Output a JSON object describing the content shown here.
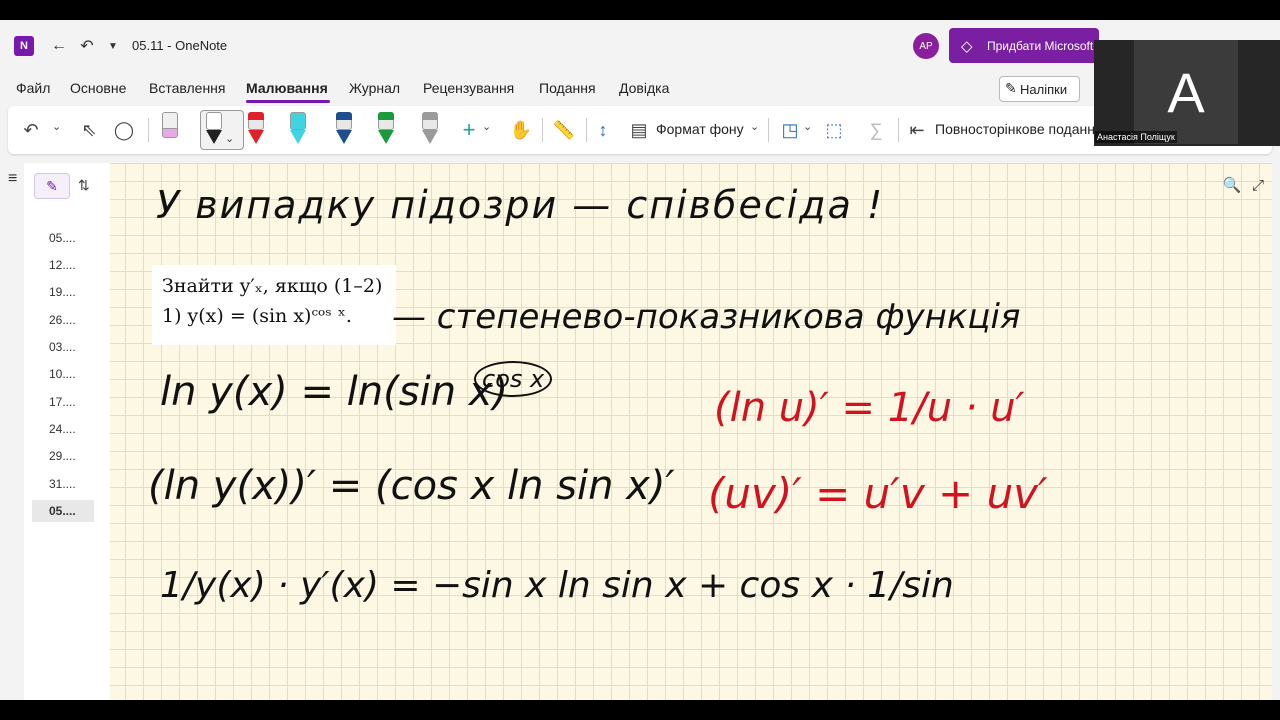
{
  "window": {
    "title": "05.11  -  OneNote",
    "avatar_initials": "AP",
    "buy_label": "Придбати Microsoft"
  },
  "menu": {
    "items": [
      "Файл",
      "Основне",
      "Вставлення",
      "Малювання",
      "Журнал",
      "Рецензування",
      "Подання",
      "Довідка"
    ],
    "active": "Малювання",
    "stickers_label": "Наліпки"
  },
  "toolbar": {
    "background_format_label": "Формат фону",
    "full_page_view_label": "Повносторінкове подання",
    "pen_colors": [
      "#222222",
      "#e0202a",
      "#3fd4e0",
      "#1f4e8c",
      "#1a9a3a",
      "#9a9a9a"
    ]
  },
  "sidebar": {
    "pages": [
      "05....",
      "12....",
      "19....",
      "26....",
      "03....",
      "10....",
      "17....",
      "24....",
      "29....",
      "31....",
      "05...."
    ],
    "active_index": 10
  },
  "note": {
    "heading_ink": "У випадку підозри — співбесіда !",
    "problem_line1": "Знайти y′ₓ, якщо (1–2)",
    "problem_line2": "1) y(x) = (sin x)ᶜᵒˢ ˣ.",
    "annotation_ink": "— степенево-показникова функція",
    "line1_ink": "ln y(x) = ln(sin x)",
    "line1_exponent_ink": "cos x",
    "line2_ink": "(ln y(x))′ = (cos x  ln sin x)′",
    "line3_ink": "1/y(x) · y′(x)  = −sin x  ln sin x + cos x · 1/sin",
    "red_formula1": "(ln u)′ = 1/u · u′",
    "red_formula2": "(uv)′ = u′v + uv′"
  },
  "video": {
    "initial": "A",
    "name": "Анастасія Поліщук"
  },
  "colors": {
    "accent": "#7719aa",
    "buy_button": "#7b1fa2",
    "ink_red": "#d2131f",
    "paper": "#fdf8e4"
  }
}
